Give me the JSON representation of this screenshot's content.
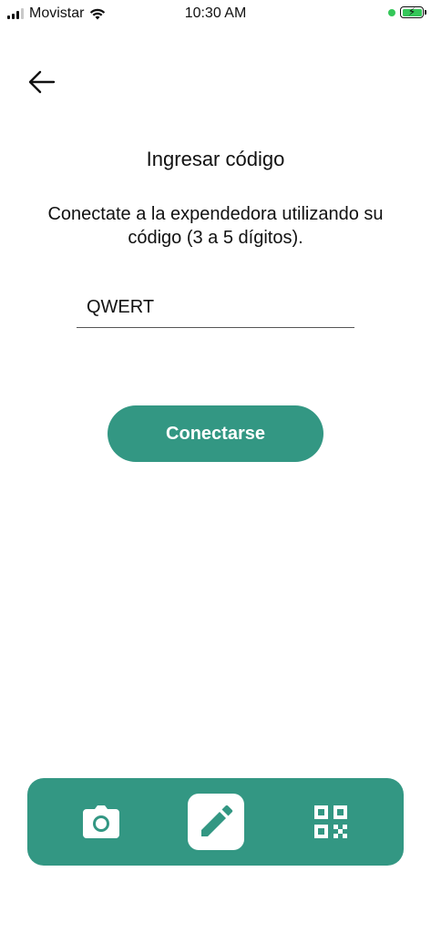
{
  "status_bar": {
    "carrier": "Movistar",
    "time": "10:30 AM",
    "battery_bolt": "⚡"
  },
  "header": {
    "back_icon": "arrow-left-icon"
  },
  "main": {
    "title": "Ingresar código",
    "description": "Conectate a la expendedora utilizando su código (3 a 5 dígitos).",
    "code_value": "QWERT",
    "connect_label": "Conectarse"
  },
  "bottom_nav": {
    "items": [
      {
        "icon": "camera-icon",
        "active": false
      },
      {
        "icon": "pencil-icon",
        "active": true
      },
      {
        "icon": "qr-code-icon",
        "active": false
      }
    ]
  },
  "colors": {
    "accent": "#339783",
    "background": "#ffffff",
    "battery": "#34c759"
  }
}
